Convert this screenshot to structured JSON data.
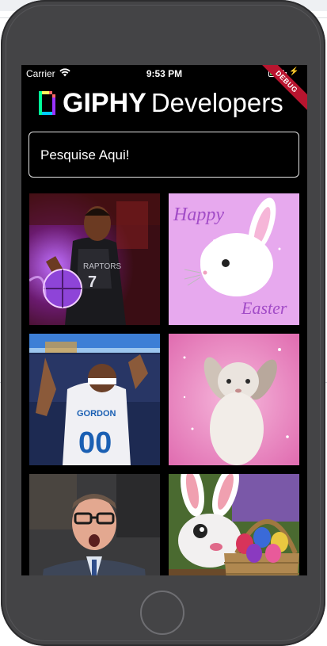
{
  "status_bar": {
    "carrier": "Carrier",
    "time": "9:53 PM"
  },
  "debug_banner": "DEBUG",
  "header": {
    "brand": "GIPHY",
    "subtitle": "Developers"
  },
  "search": {
    "placeholder": "Pesquise Aqui!"
  },
  "gifs": [
    {
      "subject": "basketball-player-raptors",
      "jersey_team": "RAPTORS",
      "jersey_number": "7"
    },
    {
      "subject": "happy-easter-bunny",
      "line1": "Happy",
      "line2": "Easter"
    },
    {
      "subject": "basketball-player-dunk",
      "jersey_name": "GORDON",
      "jersey_number": "00"
    },
    {
      "subject": "bunny-standing"
    },
    {
      "subject": "surprised-coach"
    },
    {
      "subject": "easter-bunny-basket"
    }
  ],
  "colors": {
    "screen_bg": "#000000",
    "phone_body": "#444446",
    "debug_banner": "#b8152f",
    "text": "#ffffff"
  }
}
